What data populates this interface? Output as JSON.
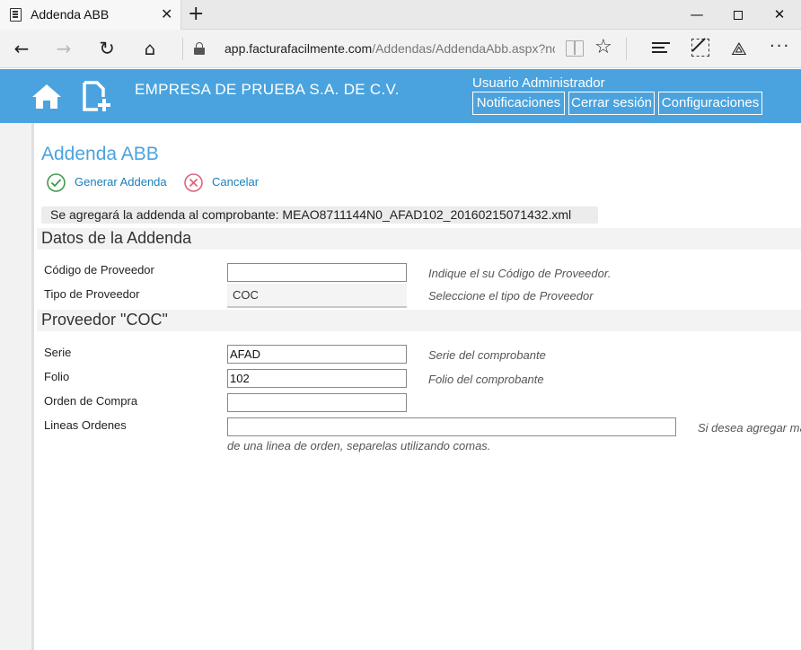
{
  "browser": {
    "tab_title": "Addenda ABB",
    "address_domain": "app.facturafacilmente.com",
    "address_path": "/Addendas/AddendaAbb.aspx?no=A"
  },
  "header": {
    "company": "EMPRESA DE PRUEBA S.A. DE C.V.",
    "user": "Usuario Administrador",
    "notifications_label": "Notificaciones",
    "logout_label": "Cerrar sesión",
    "settings_label": "Configuraciones",
    "accent_color": "#4aa3de"
  },
  "page": {
    "title": "Addenda ABB",
    "generate_label": "Generar Addenda",
    "cancel_label": "Cancelar",
    "notice": "Se agregará la addenda al comprobante: MEAO8711144N0_AFAD102_20160215071432.xml"
  },
  "section_addenda": {
    "title": "Datos de la Addenda",
    "supplier_code_label": "Código de Proveedor",
    "supplier_code_value": "",
    "supplier_code_hint": "Indique el su Código de Proveedor.",
    "supplier_type_label": "Tipo de Proveedor",
    "supplier_type_value": "COC",
    "supplier_type_hint": "Seleccione el tipo de Proveedor"
  },
  "section_coc": {
    "title": "Proveedor \"COC\"",
    "serie_label": "Serie",
    "serie_value": "AFAD",
    "serie_hint": "Serie del comprobante",
    "folio_label": "Folio",
    "folio_value": "102",
    "folio_hint": "Folio del comprobante",
    "purchase_order_label": "Orden de Compra",
    "purchase_order_value": "",
    "order_lines_label": "Lineas Ordenes",
    "order_lines_value": "",
    "order_lines_hint_part1": "Si desea agregar más",
    "order_lines_hint_part2": "de una linea de orden, separelas utilizando comas."
  }
}
